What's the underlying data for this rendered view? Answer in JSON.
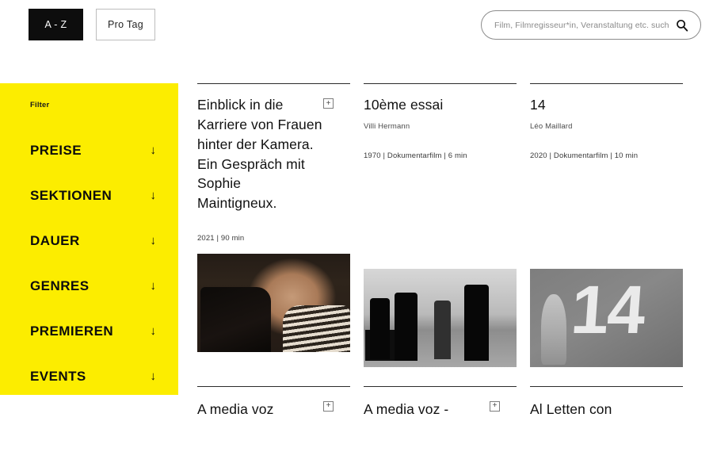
{
  "topbar": {
    "view_toggle": [
      {
        "label": "A - Z",
        "state": "active"
      },
      {
        "label": "Pro Tag",
        "state": "inactive"
      }
    ],
    "search": {
      "placeholder": "Film, Filmregisseur*in, Veranstaltung etc. such",
      "value": "",
      "icon": "search-icon"
    }
  },
  "sidebar": {
    "title": "Filter",
    "background_color": "#fced00",
    "items": [
      {
        "label": "PREISE",
        "icon": "arrow-down-icon"
      },
      {
        "label": "SEKTIONEN",
        "icon": "arrow-down-icon"
      },
      {
        "label": "DAUER",
        "icon": "arrow-down-icon"
      },
      {
        "label": "GENRES",
        "icon": "arrow-down-icon"
      },
      {
        "label": "PREMIEREN",
        "icon": "arrow-down-icon"
      },
      {
        "label": "EVENTS",
        "icon": "arrow-down-icon"
      }
    ]
  },
  "grid": {
    "rows": [
      {
        "cards": [
          {
            "title": "Einblick in die Karriere von Frauen hinter der Kamera. Ein Gespräch mit Sophie Maintigneux.",
            "person": "",
            "meta": "2021 | 90 min",
            "badge": "+",
            "image": "camerawoman-photo"
          },
          {
            "title": "10ème essai",
            "person": "Villi Hermann",
            "meta": "1970 | Dokumentarfilm | 6 min",
            "badge": "",
            "image": "filmcrew-photo"
          },
          {
            "title": "14",
            "person": "Léo Maillard",
            "meta": "2020 | Dokumentarfilm | 10 min",
            "badge": "",
            "image": "fourteen-wall-photo"
          }
        ]
      },
      {
        "cards": [
          {
            "title": "A media voz",
            "person": "",
            "meta": "",
            "badge": "+",
            "image": ""
          },
          {
            "title": "A media voz -",
            "person": "",
            "meta": "",
            "badge": "+",
            "image": ""
          },
          {
            "title": "Al Letten con",
            "person": "",
            "meta": "",
            "badge": "",
            "image": ""
          }
        ]
      }
    ]
  }
}
